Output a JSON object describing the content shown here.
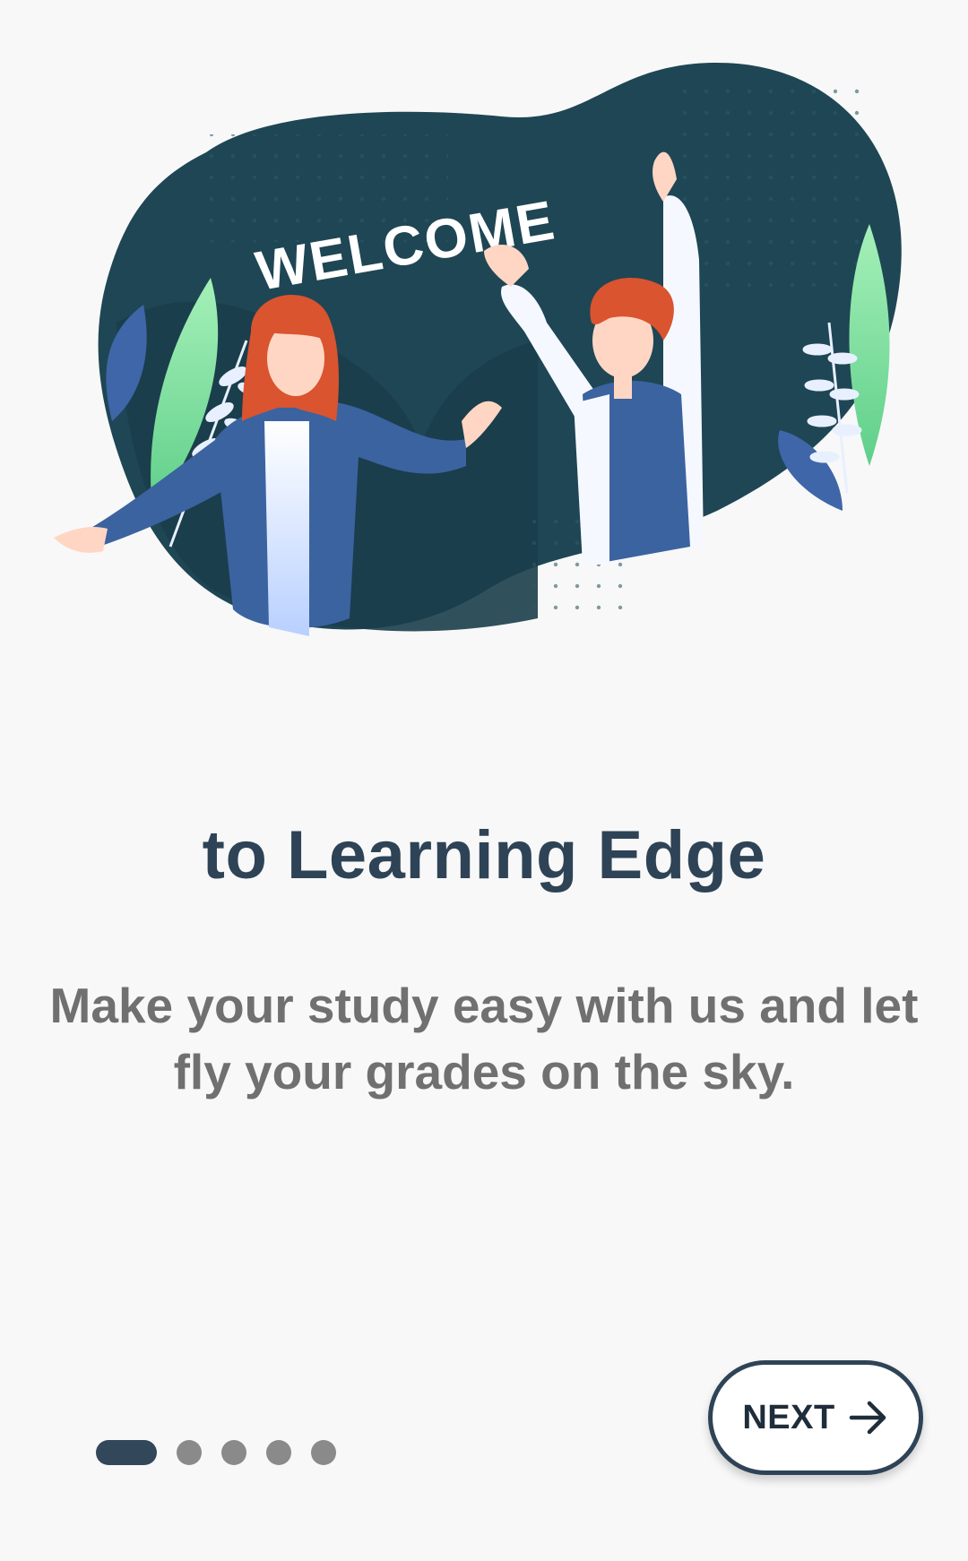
{
  "illustration": {
    "banner_text": "WELCOME",
    "colors": {
      "blob": "#1f4654",
      "blob_dark": "#1a3d4a",
      "leaf_green": "#8fe3a0",
      "leaf_blue": "#3f66a8",
      "hair": "#d9542f",
      "skin": "#ffd6c4",
      "jacket": "#3b63a0",
      "shirt": "#f5f8ff"
    }
  },
  "title": "to Learning Edge",
  "subtitle_line1": "Make your study easy with us and let",
  "subtitle_line2": "fly your grades on the sky.",
  "pager": {
    "total_pages": 5,
    "current_page": 1
  },
  "next_button": {
    "label": "NEXT",
    "icon": "arrow-right-icon"
  },
  "colors": {
    "background": "#f8f8f8",
    "title": "#2e4356",
    "subtitle": "#707070",
    "dot_active": "#33475a",
    "dot_inactive": "#8a8a8a"
  }
}
